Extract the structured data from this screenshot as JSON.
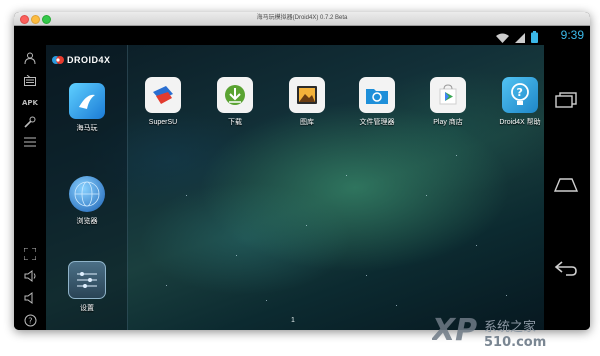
{
  "window": {
    "title": "海马玩模拟器(Droid4X) 0.7.2 Beta"
  },
  "statusbar": {
    "time": "9:39"
  },
  "brand": {
    "logo_text": "DROID4X"
  },
  "shortcuts": [
    {
      "label": "海马玩"
    },
    {
      "label": "浏览器"
    },
    {
      "label": "设置"
    }
  ],
  "apps": [
    {
      "label": "SuperSU"
    },
    {
      "label": "下载"
    },
    {
      "label": "图库"
    },
    {
      "label": "文件管理器"
    },
    {
      "label": "Play 商店"
    },
    {
      "label": "Droid4X 帮助"
    }
  ],
  "page_indicator": "1",
  "watermark": {
    "brand": "XP",
    "site": "系统之家",
    "domain": "510.com"
  },
  "icons": {
    "sidebar": [
      "account-icon",
      "keyboard-icon",
      "apk-install-icon",
      "settings-wrench-icon",
      "menu-icon",
      "fullscreen-icon",
      "volume-up-icon",
      "volume-down-icon",
      "help-icon"
    ],
    "nav": [
      "recent-apps-icon",
      "home-icon",
      "back-icon"
    ]
  }
}
